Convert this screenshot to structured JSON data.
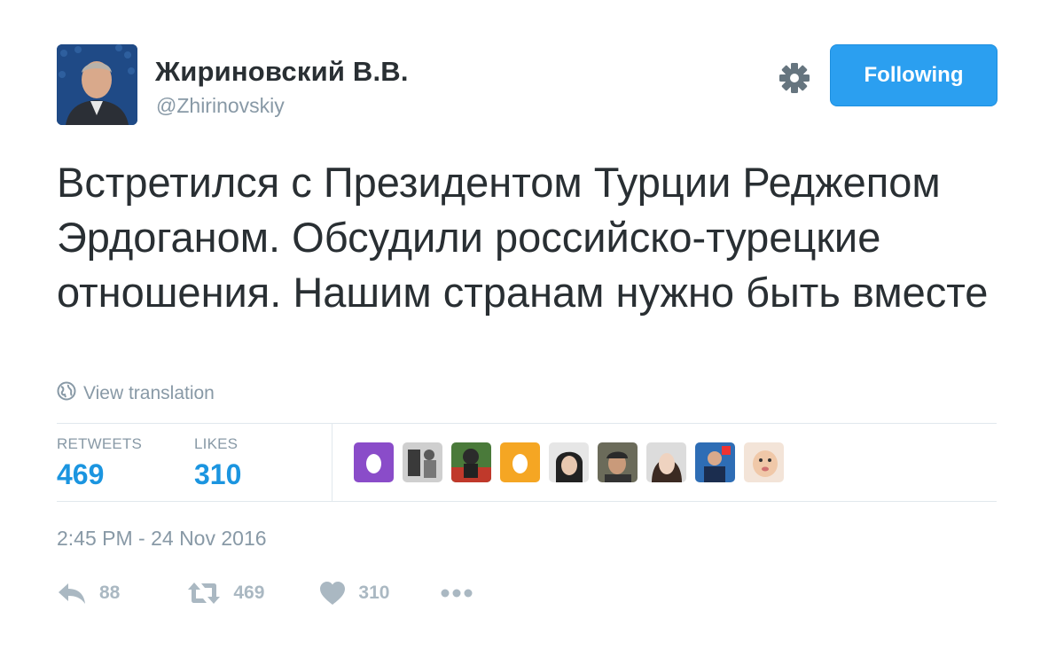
{
  "author": {
    "display_name": "Жириновский В.В.",
    "handle": "@Zhirinovskiy"
  },
  "follow_button": {
    "label": "Following"
  },
  "tweet": {
    "text": "Встретился с Президентом Турции Реджепом Эрдоганом. Обсудили российско-турецкие отношения. Нашим странам нужно быть вместе",
    "translate_label": "View translation",
    "timestamp": "2:45 PM - 24 Nov 2016"
  },
  "stats": {
    "retweets_label": "RETWEETS",
    "retweets_value": "469",
    "likes_label": "LIKES",
    "likes_value": "310"
  },
  "actions": {
    "reply_count": "88",
    "retweet_count": "469",
    "like_count": "310"
  },
  "colors": {
    "accent_blue": "#1b95e0",
    "button_blue": "#2b9ff0",
    "muted_gray": "#8899a6",
    "action_gray": "#aab8c2",
    "divider": "#e1e8ed",
    "egg_purple": "#8a4cc9",
    "egg_orange": "#f5a623"
  },
  "icons": {
    "settings": "gear-icon",
    "translate": "globe-icon",
    "reply": "reply-icon",
    "retweet": "retweet-icon",
    "like": "heart-icon",
    "more": "more-dots-icon"
  }
}
